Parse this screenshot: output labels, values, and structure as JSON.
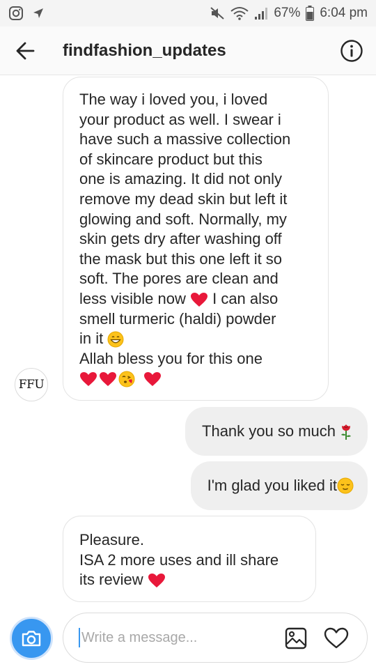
{
  "status_bar": {
    "battery": "67%",
    "time": "6:04 pm",
    "icons": [
      "instagram-icon",
      "send-icon",
      "mute-icon",
      "wifi-icon",
      "signal-icon",
      "battery-icon"
    ]
  },
  "header": {
    "title": "findfashion_updates",
    "back_icon": "arrow-left-icon",
    "info_icon": "info-icon"
  },
  "avatar": {
    "text": "FFU"
  },
  "messages": [
    {
      "direction": "incoming",
      "lines": [
        "The way i loved you, i loved",
        "your product as well. I swear i",
        "have such a massive collection",
        "of skincare product but this",
        "one is amazing. It did not only",
        "remove my dead skin but left it",
        "glowing and soft. Normally, my",
        "skin gets dry after washing off",
        "the mask but this one left it so",
        "soft. The pores are clean and",
        "less visible now",
        "I can also",
        "smell turmeric (haldi) powder",
        "in it",
        "Allah bless you for this one"
      ],
      "emojis": [
        "red-heart",
        "grinning-face",
        "red-heart",
        "red-heart",
        "face-blowing-kiss",
        "red-heart"
      ]
    },
    {
      "direction": "outgoing",
      "text": "Thank you so much",
      "emoji": "rose"
    },
    {
      "direction": "outgoing",
      "text": "I'm glad you liked it",
      "emoji": "relieved-face"
    },
    {
      "direction": "incoming",
      "lines": [
        "Pleasure.",
        "ISA 2 more uses and ill share",
        "its review"
      ],
      "emoji": "red-heart"
    }
  ],
  "composer": {
    "placeholder": "Write a message...",
    "value": "",
    "icons": [
      "camera-icon",
      "gallery-icon",
      "heart-icon"
    ]
  },
  "colors": {
    "accent": "#3897f0",
    "incoming_bubble_border": "#e3e3e3",
    "outgoing_bubble": "#efefef",
    "heart": "#e8183a"
  }
}
